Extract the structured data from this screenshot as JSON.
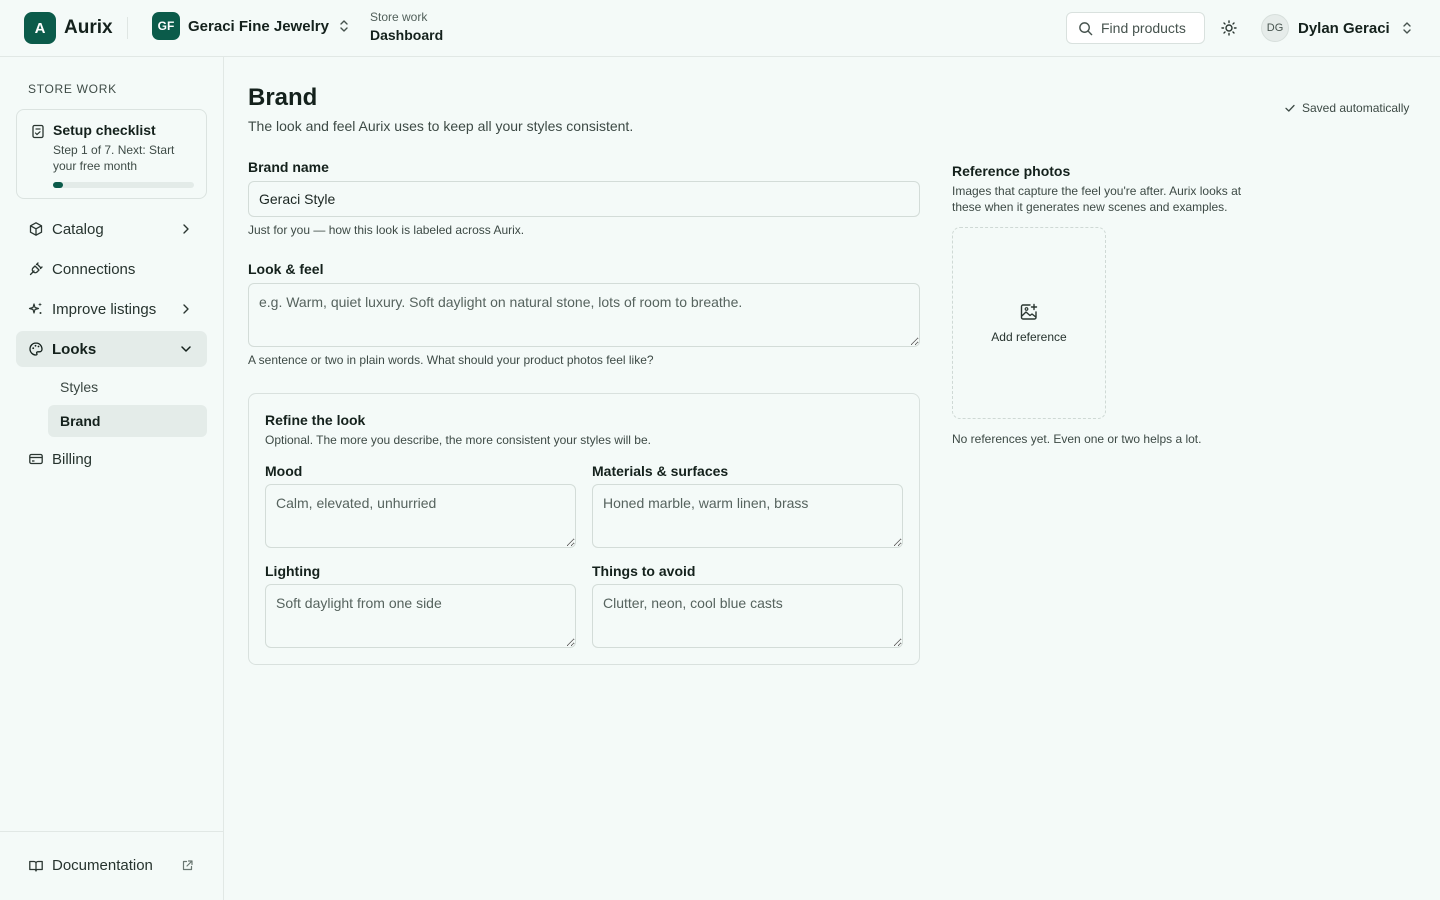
{
  "app": {
    "logo_letter": "A",
    "name": "Aurix"
  },
  "store": {
    "initials": "GF",
    "name": "Geraci Fine Jewelry"
  },
  "breadcrumb": {
    "section": "Store work",
    "page": "Dashboard"
  },
  "header": {
    "search_label": "Find products"
  },
  "user": {
    "initials": "DG",
    "name": "Dylan Geraci"
  },
  "sidebar": {
    "heading": "STORE WORK",
    "checklist": {
      "title": "Setup checklist",
      "subtitle": "Step 1 of 7. Next: Start your free month",
      "progress": 0.0714
    },
    "items": [
      {
        "label": "Catalog",
        "icon": "package-icon"
      },
      {
        "label": "Connections",
        "icon": "plug-icon"
      },
      {
        "label": "Improve listings",
        "icon": "sparkles-icon"
      },
      {
        "label": "Looks",
        "icon": "palette-icon",
        "active": true
      },
      {
        "label": "Billing",
        "icon": "credit-card-icon"
      }
    ],
    "sub_items": [
      {
        "label": "Styles"
      },
      {
        "label": "Brand",
        "active": true
      }
    ],
    "documentation": "Documentation"
  },
  "main": {
    "title": "Brand",
    "subtitle": "The look and feel Aurix uses to keep all your styles consistent.",
    "saved": "Saved automatically",
    "brand_name": {
      "label": "Brand name",
      "value": "Geraci Style",
      "hint": "Just for you — how this look is labeled across Aurix."
    },
    "look_feel": {
      "label": "Look & feel",
      "placeholder": "e.g. Warm, quiet luxury. Soft daylight on natural stone, lots of room to breathe.",
      "hint": "A sentence or two in plain words. What should your product photos feel like?"
    },
    "refine": {
      "title": "Refine the look",
      "subtitle": "Optional. The more you describe, the more consistent your styles will be.",
      "mood": {
        "label": "Mood",
        "placeholder": "Calm, elevated, unhurried"
      },
      "materials": {
        "label": "Materials & surfaces",
        "placeholder": "Honed marble, warm linen, brass"
      },
      "lighting": {
        "label": "Lighting",
        "placeholder": "Soft daylight from one side"
      },
      "avoid": {
        "label": "Things to avoid",
        "placeholder": "Clutter, neon, cool blue casts"
      }
    },
    "references": {
      "title": "Reference photos",
      "subtitle": "Images that capture the feel you're after. Aurix looks at these when it generates new scenes and examples.",
      "add_label": "Add reference",
      "empty": "No references yet. Even one or two helps a lot."
    }
  },
  "colors": {
    "accent": "#0b5b4a",
    "background": "#f4faf8",
    "active_bg": "#e4ece9"
  }
}
